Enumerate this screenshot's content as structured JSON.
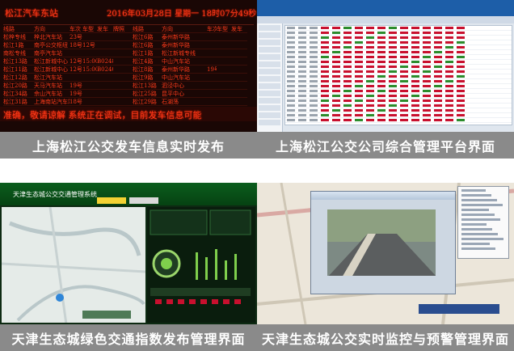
{
  "panels": [
    {
      "caption": "上海松江公交发车信息实时发布",
      "board": {
        "station": "松江汽车东站",
        "datetime": "2016年03月28日 星期一 18时07分49秒",
        "headers": [
          "线路",
          "方向",
          "车次",
          "车型",
          "发车",
          "牌照",
          "线路",
          "方向",
          "车次",
          "车型",
          "发车"
        ],
        "rows": [
          [
            "松梓专线",
            "梓北汽车站",
            "23号",
            "",
            "",
            "",
            "松江6路",
            "泰州新华路",
            "",
            "",
            ""
          ],
          [
            "松江1路",
            "南亭公交枢纽",
            "18号",
            "12号",
            "",
            "",
            "松江6路",
            "泰州新华路",
            "",
            "",
            ""
          ],
          [
            "南松专线",
            "南亭汽车站",
            "",
            "",
            "",
            "",
            "松江1路",
            "松江新城专线",
            "",
            "",
            ""
          ],
          [
            "松江13路",
            "松江新城中心",
            "12号",
            "15:00",
            "B02484",
            "",
            "松江4路",
            "中山汽车站",
            "",
            "",
            ""
          ],
          [
            "松江11路",
            "松江新城中心",
            "12号",
            "15:00",
            "B02404",
            "",
            "松江8路",
            "泰州新华路",
            "19号",
            "",
            ""
          ],
          [
            "松江12路",
            "松江汽车站",
            "",
            "",
            "",
            "",
            "松江9路",
            "中山汽车站",
            "",
            "",
            ""
          ],
          [
            "松江20路",
            "天马汽车站",
            "19号",
            "",
            "",
            "",
            "松江13路",
            "泗泾中心",
            "",
            "",
            ""
          ],
          [
            "松江34路",
            "佘山汽车站",
            "19号",
            "",
            "",
            "",
            "松江25路",
            "昆平中心",
            "",
            "",
            ""
          ],
          [
            "松江31路",
            "上海南站汽车站",
            "18号",
            "",
            "",
            "",
            "松江29路",
            "石湖荡",
            "",
            "",
            ""
          ],
          [
            "沪松线",
            "西郊汽车站",
            "26号",
            "",
            "",
            "",
            "松江30路",
            "玉树南路",
            "",
            "",
            ""
          ]
        ],
        "ticker": "准确，敬请谅解 系统正在调试，目前发车信息可能"
      }
    },
    {
      "caption": "上海松江公交公司综合管理平台界面"
    },
    {
      "caption": "天津生态城绿色交通指数发布管理界面",
      "window_title": "天津生态城公交交通管理系统"
    },
    {
      "caption": "天津生态城公交实时监控与预警管理界面"
    }
  ],
  "colors": {
    "caption_bg": "#8a8a8a",
    "led_red": "#ff3a1a",
    "platform_blue": "#1d5ea8",
    "eco_green": "#0b5e1d"
  }
}
